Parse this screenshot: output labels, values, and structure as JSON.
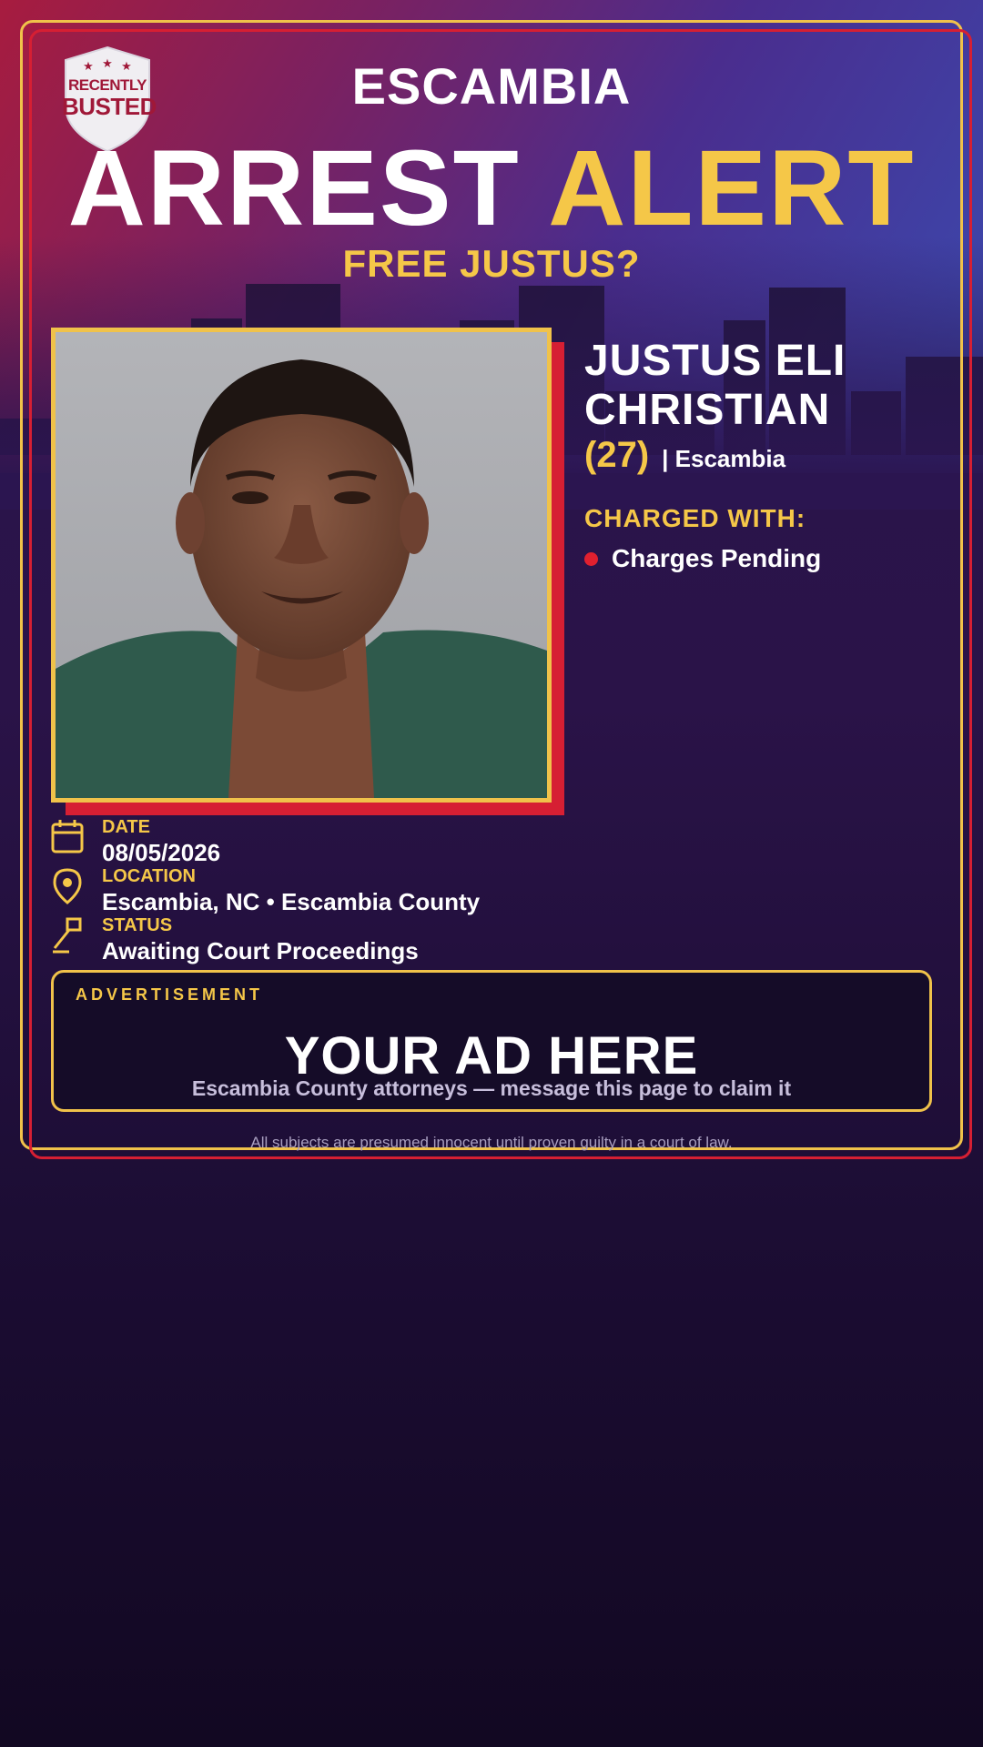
{
  "header": {
    "county": "ESCAMBIA",
    "title_part1": "ARREST",
    "title_part2": "ALERT",
    "subtitle": "FREE JUSTUS?"
  },
  "logo": {
    "line1": "RECENTLY",
    "line2": "BUSTED",
    "icon": "shield-stars-icon"
  },
  "subject": {
    "name_line1": "JUSTUS ELI",
    "name_line2": "CHRISTIAN",
    "age": "(27)",
    "location_short": "| Escambia",
    "charged_label": "CHARGED WITH:",
    "charges": [
      "Charges Pending"
    ]
  },
  "details": {
    "date_label": "DATE",
    "date_value": "08/05/2026",
    "location_label": "LOCATION",
    "location_value": "Escambia, NC • Escambia County",
    "status_label": "STATUS",
    "status_value": "Awaiting Court Proceedings"
  },
  "ad": {
    "label": "ADVERTISEMENT",
    "title": "YOUR AD HERE",
    "subtitle": "Escambia County attorneys — message this page to claim it"
  },
  "disclaimer": "All subjects are presumed innocent until proven guilty in a court of law.",
  "colors": {
    "accent_yellow": "#f5c748",
    "accent_red": "#d61f33",
    "background": "#2b1550"
  }
}
